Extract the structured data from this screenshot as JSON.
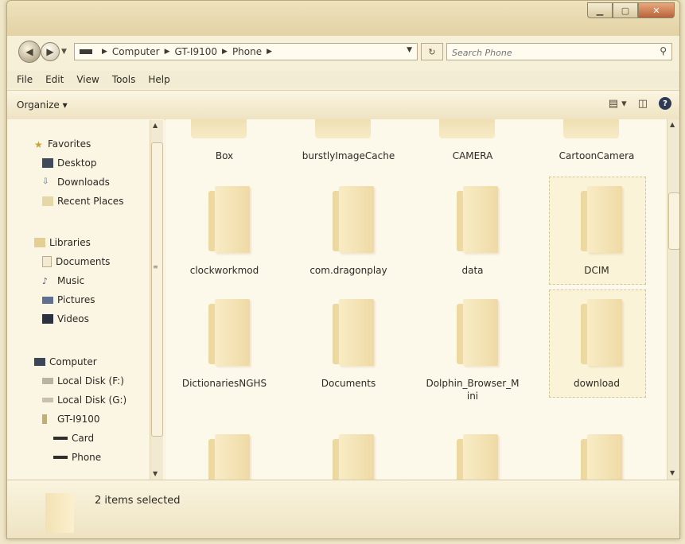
{
  "address": {
    "crumbs": [
      "Computer",
      "GT-I9100",
      "Phone"
    ]
  },
  "search": {
    "placeholder": "Search Phone"
  },
  "menu": [
    "File",
    "Edit",
    "View",
    "Tools",
    "Help"
  ],
  "toolbar": {
    "organize": "Organize ▾"
  },
  "nav": {
    "favorites": {
      "header": "Favorites",
      "items": [
        "Desktop",
        "Downloads",
        "Recent Places"
      ]
    },
    "libraries": {
      "header": "Libraries",
      "items": [
        "Documents",
        "Music",
        "Pictures",
        "Videos"
      ]
    },
    "computer": {
      "header": "Computer",
      "items": [
        "Local Disk (F:)",
        "Local Disk (G:)",
        "GT-I9100",
        "Card",
        "Phone"
      ]
    }
  },
  "folders": {
    "top": [
      "Box",
      "burstlyImageCache",
      "CAMERA",
      "CartoonCamera"
    ],
    "row1": [
      "clockworkmod",
      "com.dragonplay",
      "data",
      "DCIM"
    ],
    "row2": [
      "DictionariesNGHS",
      "Documents",
      "Dolphin_Browser_Mini",
      "download"
    ]
  },
  "status": {
    "selected": "2 items selected"
  }
}
